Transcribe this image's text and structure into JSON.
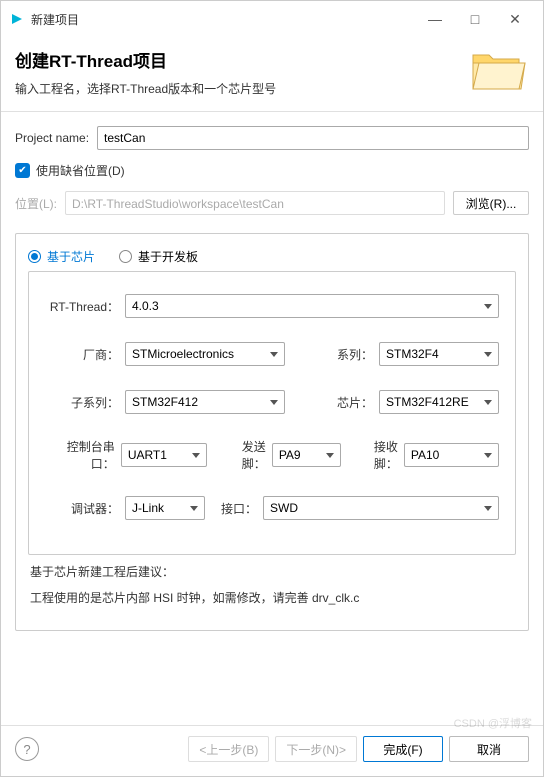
{
  "window": {
    "title": "新建项目",
    "minimize": "—",
    "maximize": "□",
    "close": "✕"
  },
  "header": {
    "title": "创建RT-Thread项目",
    "subtitle": "输入工程名，选择RT-Thread版本和一个芯片型号"
  },
  "project": {
    "name_label": "Project name:",
    "name_value": "testCan",
    "default_loc_label": "使用缺省位置(D)",
    "loc_label": "位置(L):",
    "loc_value": "D:\\RT-ThreadStudio\\workspace\\testCan",
    "browse_label": "浏览(R)..."
  },
  "tabs": {
    "chip": "基于芯片",
    "board": "基于开发板"
  },
  "fields": {
    "rt_label": "RT-Thread：",
    "rt_value": "4.0.3",
    "vendor_label": "厂商：",
    "vendor_value": "STMicroelectronics",
    "series_label": "系列：",
    "series_value": "STM32F4",
    "subseries_label": "子系列：",
    "subseries_value": "STM32F412",
    "chip_label": "芯片：",
    "chip_value": "STM32F412RE",
    "console_label": "控制台串口：",
    "console_value": "UART1",
    "tx_label": "发送脚：",
    "tx_value": "PA9",
    "rx_label": "接收脚：",
    "rx_value": "PA10",
    "debugger_label": "调试器：",
    "debugger_value": "J-Link",
    "iface_label": "接口：",
    "iface_value": "SWD"
  },
  "suggest": {
    "title": "基于芯片新建工程后建议：",
    "line1": "工程使用的是芯片内部 HSI 时钟，如需修改，请完善 drv_clk.c"
  },
  "footer": {
    "help": "?",
    "back": "<上一步(B)",
    "next": "下一步(N)>",
    "finish": "完成(F)",
    "cancel": "取消"
  },
  "watermark": "CSDN @浮博客"
}
